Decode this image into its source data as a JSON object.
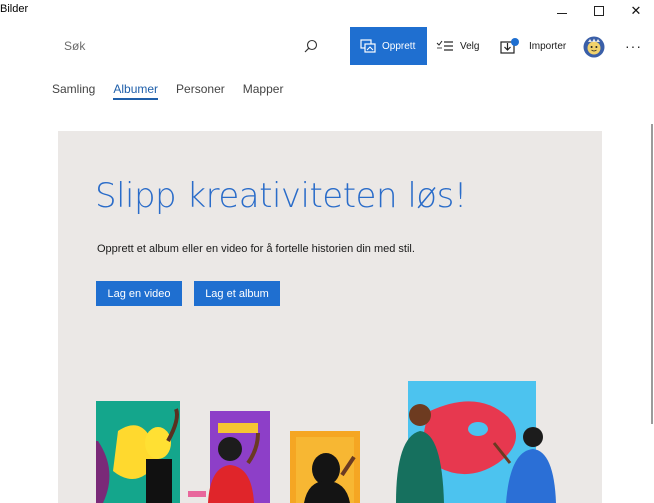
{
  "window": {
    "title": "Bilder"
  },
  "toolbar": {
    "search_placeholder": "Søk",
    "create_label": "Opprett",
    "select_label": "Velg",
    "import_label": "Importer",
    "more_label": "···"
  },
  "tabs": [
    {
      "label": "Samling",
      "active": false
    },
    {
      "label": "Albumer",
      "active": true
    },
    {
      "label": "Personer",
      "active": false
    },
    {
      "label": "Mapper",
      "active": false
    }
  ],
  "hero": {
    "title": "Slipp kreativiteten løs!",
    "subtitle": "Opprett et album eller en video for å fortelle historien din med stil.",
    "video_button": "Lag en video",
    "album_button": "Lag et album"
  },
  "colors": {
    "accent": "#1f6fd0",
    "hero_bg": "#ebe8e6",
    "hero_title": "#2a6cc9"
  }
}
